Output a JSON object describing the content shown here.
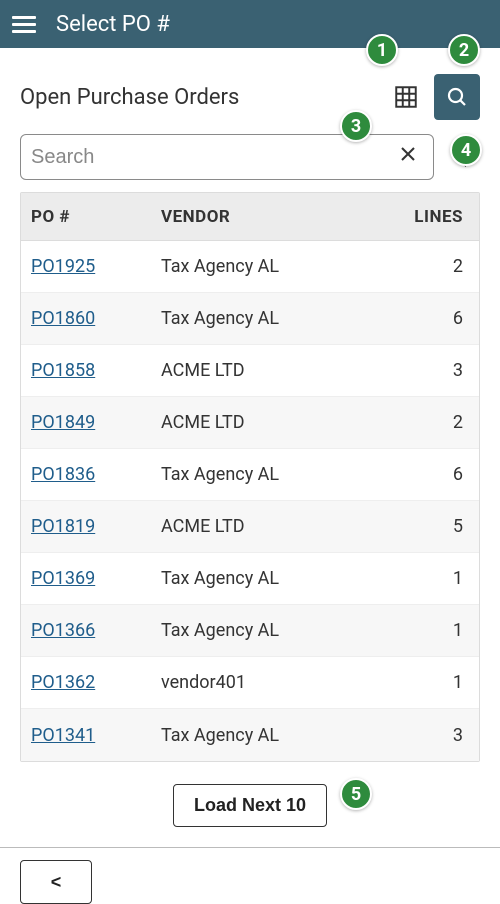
{
  "topbar": {
    "title": "Select PO #"
  },
  "heading": "Open Purchase Orders",
  "search": {
    "placeholder": "Search",
    "value": ""
  },
  "columns": {
    "po": "PO #",
    "vendor": "VENDOR",
    "lines": "LINES"
  },
  "rows": [
    {
      "po": "PO1925",
      "vendor": "Tax Agency AL",
      "lines": "2"
    },
    {
      "po": "PO1860",
      "vendor": "Tax Agency AL",
      "lines": "6"
    },
    {
      "po": "PO1858",
      "vendor": "ACME LTD",
      "lines": "3"
    },
    {
      "po": "PO1849",
      "vendor": "ACME LTD",
      "lines": "2"
    },
    {
      "po": "PO1836",
      "vendor": "Tax Agency AL",
      "lines": "6"
    },
    {
      "po": "PO1819",
      "vendor": "ACME LTD",
      "lines": "5"
    },
    {
      "po": "PO1369",
      "vendor": "Tax Agency AL",
      "lines": "1"
    },
    {
      "po": "PO1366",
      "vendor": "Tax Agency AL",
      "lines": "1"
    },
    {
      "po": "PO1362",
      "vendor": "vendor401",
      "lines": "1"
    },
    {
      "po": "PO1341",
      "vendor": "Tax Agency AL",
      "lines": "3"
    }
  ],
  "loadNext": "Load Next 10",
  "backLabel": "<",
  "annotations": {
    "a1": "1",
    "a2": "2",
    "a3": "3",
    "a4": "4",
    "a5": "5"
  }
}
